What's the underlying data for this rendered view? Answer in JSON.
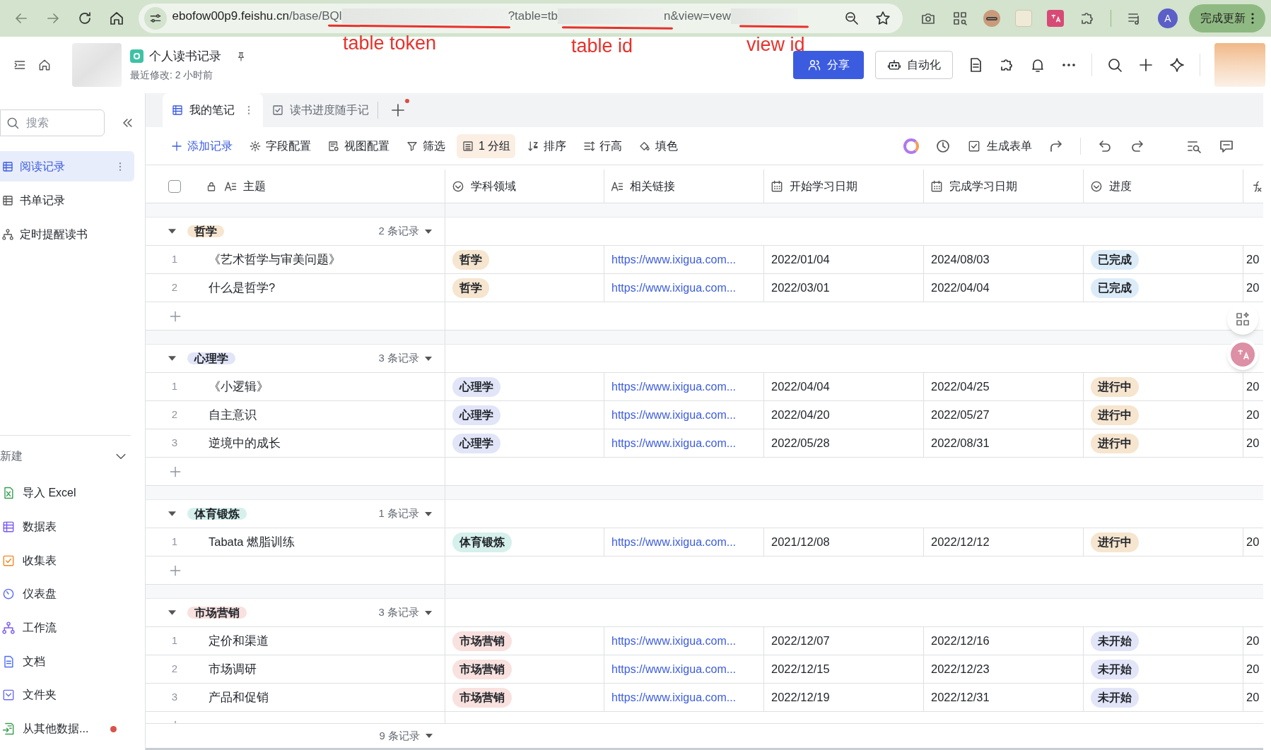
{
  "browser": {
    "url": [
      {
        "kind": "host",
        "text": "ebofow00p9.feishu.cn"
      },
      {
        "kind": "path",
        "text": "/base/BQl"
      },
      {
        "kind": "blur"
      },
      {
        "kind": "path",
        "text": "?table=tb"
      },
      {
        "kind": "blur"
      },
      {
        "kind": "path",
        "text": "n&view=vew"
      },
      {
        "kind": "blur"
      }
    ],
    "profile": "A",
    "update_button": "完成更新"
  },
  "annotations": [
    {
      "text": "table token"
    },
    {
      "text": "table id"
    },
    {
      "text": "view id"
    }
  ],
  "header": {
    "title": "个人读书记录",
    "subtitle": "最近修改: 2 小时前",
    "share": "分享",
    "automation": "自动化"
  },
  "sidebar": {
    "search": {
      "placeholder": "搜索"
    },
    "items": [
      {
        "label": "阅读记录",
        "kind": "table",
        "selected": true
      },
      {
        "label": "书单记录",
        "kind": "table",
        "selected": false
      },
      {
        "label": "定时提醒读书",
        "kind": "workflow",
        "selected": false
      }
    ],
    "new_section": {
      "label": "新建",
      "items": [
        {
          "label": "导入 Excel",
          "kind": "excel",
          "dot": false
        },
        {
          "label": "数据表",
          "kind": "table",
          "dot": false
        },
        {
          "label": "收集表",
          "kind": "form",
          "dot": false
        },
        {
          "label": "仪表盘",
          "kind": "dashboard",
          "dot": false
        },
        {
          "label": "工作流",
          "kind": "workflow",
          "dot": false
        },
        {
          "label": "文档",
          "kind": "doc",
          "dot": false
        },
        {
          "label": "文件夹",
          "kind": "folder",
          "dot": false
        },
        {
          "label": "从其他数据...",
          "kind": "import",
          "dot": true
        }
      ]
    }
  },
  "tabs": [
    {
      "label": "我的笔记",
      "kind": "grid",
      "selected": true
    },
    {
      "label": "读书进度随手记",
      "kind": "form",
      "selected": false
    }
  ],
  "toolbar": [
    {
      "label": "添加记录",
      "kind": "add",
      "selected": false
    },
    {
      "label": "字段配置",
      "kind": "gear",
      "selected": false
    },
    {
      "label": "视图配置",
      "kind": "view",
      "selected": false
    },
    {
      "label": "筛选",
      "kind": "filter",
      "selected": false
    },
    {
      "label": "1 分组",
      "kind": "group",
      "selected": true
    },
    {
      "label": "排序",
      "kind": "sort",
      "selected": false
    },
    {
      "label": "行高",
      "kind": "height",
      "selected": false
    },
    {
      "label": "填色",
      "kind": "fill",
      "selected": false
    }
  ],
  "generate_form": "生成表单",
  "select_all": {
    "checked": false
  },
  "columns": [
    {
      "label": "主题",
      "kind": "text"
    },
    {
      "label": "学科领域",
      "kind": "select"
    },
    {
      "label": "相关链接",
      "kind": "text"
    },
    {
      "label": "开始学习日期",
      "kind": "date"
    },
    {
      "label": "完成学习日期",
      "kind": "date"
    },
    {
      "label": "进度",
      "kind": "select"
    },
    {
      "kind": "formula"
    }
  ],
  "groups": [
    {
      "tag": "哲学",
      "color": "#f6e5cf",
      "count": "2 条记录",
      "expanded": true,
      "rows": [
        {
          "index": "1",
          "title": "《艺术哲学与审美问题》",
          "field": "哲学",
          "link": "https://www.ixigua.com...",
          "start": "2022/01/04",
          "end": "2024/08/03",
          "progress": {
            "text": "已完成",
            "color": "#dcebf8"
          },
          "column_7": "20"
        },
        {
          "index": "2",
          "title": "什么是哲学?",
          "field": "哲学",
          "link": "https://www.ixigua.com...",
          "start": "2022/03/01",
          "end": "2022/04/04",
          "progress": {
            "text": "已完成",
            "color": "#dcebf8"
          },
          "column_7": "20"
        }
      ]
    },
    {
      "tag": "心理学",
      "color": "#e2e5f8",
      "count": "3 条记录",
      "expanded": true,
      "rows": [
        {
          "index": "1",
          "title": "《小逻辑》",
          "field": "心理学",
          "link": "https://www.ixigua.com...",
          "start": "2022/04/04",
          "end": "2022/04/25",
          "progress": {
            "text": "进行中",
            "color": "#f6e5cf"
          },
          "column_7": "20"
        },
        {
          "index": "2",
          "title": "自主意识",
          "field": "心理学",
          "link": "https://www.ixigua.com...",
          "start": "2022/04/20",
          "end": "2022/05/27",
          "progress": {
            "text": "进行中",
            "color": "#f6e5cf"
          },
          "column_7": "20"
        },
        {
          "index": "3",
          "title": "逆境中的成长",
          "field": "心理学",
          "link": "https://www.ixigua.com...",
          "start": "2022/05/28",
          "end": "2022/08/31",
          "progress": {
            "text": "进行中",
            "color": "#f6e5cf"
          },
          "column_7": "20"
        }
      ]
    },
    {
      "tag": "体育锻炼",
      "color": "#d6f0ec",
      "count": "1 条记录",
      "expanded": true,
      "rows": [
        {
          "index": "1",
          "title": "Tabata 燃脂训练",
          "field": "体育锻炼",
          "link": "https://www.ixigua.com...",
          "start": "2021/12/08",
          "end": "2022/12/12",
          "progress": {
            "text": "进行中",
            "color": "#f6e5cf"
          },
          "column_7": "20"
        }
      ]
    },
    {
      "tag": "市场营销",
      "color": "#f8e1de",
      "count": "3 条记录",
      "expanded": true,
      "rows": [
        {
          "index": "1",
          "title": "定价和渠道",
          "field": "市场营销",
          "link": "https://www.ixigua.com...",
          "start": "2022/12/07",
          "end": "2022/12/16",
          "progress": {
            "text": "未开始",
            "color": "#e2e5f8"
          },
          "column_7": "20"
        },
        {
          "index": "2",
          "title": "市场调研",
          "field": "市场营销",
          "link": "https://www.ixigua.com...",
          "start": "2022/12/15",
          "end": "2022/12/23",
          "progress": {
            "text": "未开始",
            "color": "#e2e5f8"
          },
          "column_7": "20"
        },
        {
          "index": "3",
          "title": "产品和促销",
          "field": "市场营销",
          "link": "https://www.ixigua.com...",
          "start": "2022/12/19",
          "end": "2022/12/31",
          "progress": {
            "text": "未开始",
            "color": "#e2e5f8"
          },
          "column_7": "20"
        }
      ]
    }
  ],
  "footer": {
    "count": "9 条记录"
  }
}
